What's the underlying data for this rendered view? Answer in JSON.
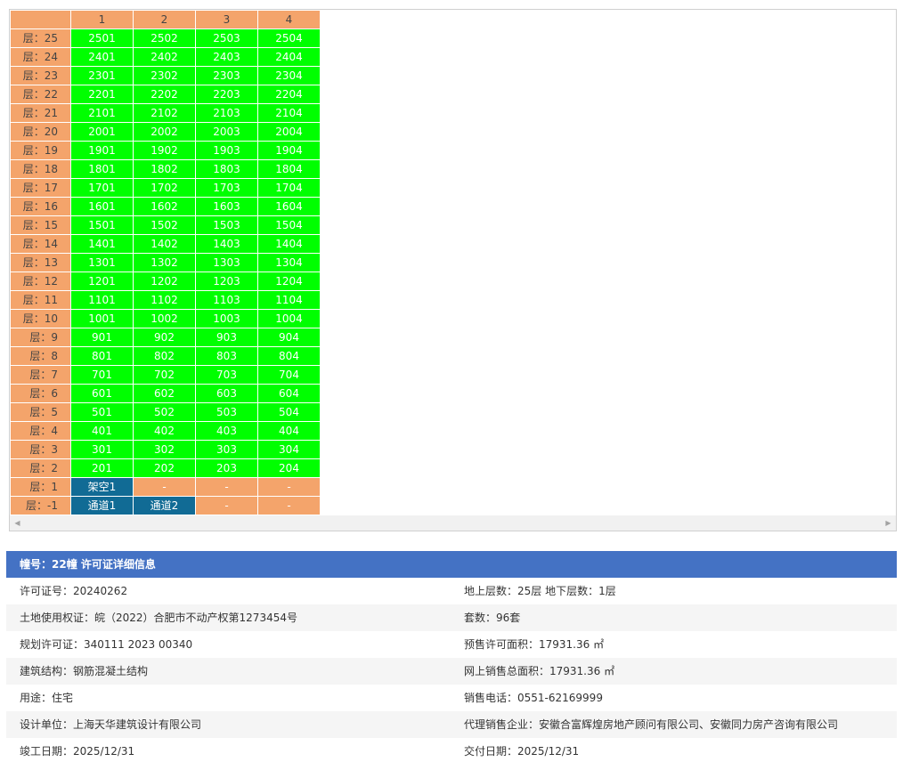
{
  "grid": {
    "columns": [
      "1",
      "2",
      "3",
      "4"
    ],
    "rows": [
      {
        "floor": "层：25",
        "units": [
          "2501",
          "2502",
          "2503",
          "2504"
        ],
        "types": [
          "unit",
          "unit",
          "unit",
          "unit"
        ]
      },
      {
        "floor": "层：24",
        "units": [
          "2401",
          "2402",
          "2403",
          "2404"
        ],
        "types": [
          "unit",
          "unit",
          "unit",
          "unit"
        ]
      },
      {
        "floor": "层：23",
        "units": [
          "2301",
          "2302",
          "2303",
          "2304"
        ],
        "types": [
          "unit",
          "unit",
          "unit",
          "unit"
        ]
      },
      {
        "floor": "层：22",
        "units": [
          "2201",
          "2202",
          "2203",
          "2204"
        ],
        "types": [
          "unit",
          "unit",
          "unit",
          "unit"
        ]
      },
      {
        "floor": "层：21",
        "units": [
          "2101",
          "2102",
          "2103",
          "2104"
        ],
        "types": [
          "unit",
          "unit",
          "unit",
          "unit"
        ]
      },
      {
        "floor": "层：20",
        "units": [
          "2001",
          "2002",
          "2003",
          "2004"
        ],
        "types": [
          "unit",
          "unit",
          "unit",
          "unit"
        ]
      },
      {
        "floor": "层：19",
        "units": [
          "1901",
          "1902",
          "1903",
          "1904"
        ],
        "types": [
          "unit",
          "unit",
          "unit",
          "unit"
        ]
      },
      {
        "floor": "层：18",
        "units": [
          "1801",
          "1802",
          "1803",
          "1804"
        ],
        "types": [
          "unit",
          "unit",
          "unit",
          "unit"
        ]
      },
      {
        "floor": "层：17",
        "units": [
          "1701",
          "1702",
          "1703",
          "1704"
        ],
        "types": [
          "unit",
          "unit",
          "unit",
          "unit"
        ]
      },
      {
        "floor": "层：16",
        "units": [
          "1601",
          "1602",
          "1603",
          "1604"
        ],
        "types": [
          "unit",
          "unit",
          "unit",
          "unit"
        ]
      },
      {
        "floor": "层：15",
        "units": [
          "1501",
          "1502",
          "1503",
          "1504"
        ],
        "types": [
          "unit",
          "unit",
          "unit",
          "unit"
        ]
      },
      {
        "floor": "层：14",
        "units": [
          "1401",
          "1402",
          "1403",
          "1404"
        ],
        "types": [
          "unit",
          "unit",
          "unit",
          "unit"
        ]
      },
      {
        "floor": "层：13",
        "units": [
          "1301",
          "1302",
          "1303",
          "1304"
        ],
        "types": [
          "unit",
          "unit",
          "unit",
          "unit"
        ]
      },
      {
        "floor": "层：12",
        "units": [
          "1201",
          "1202",
          "1203",
          "1204"
        ],
        "types": [
          "unit",
          "unit",
          "unit",
          "unit"
        ]
      },
      {
        "floor": "层：11",
        "units": [
          "1101",
          "1102",
          "1103",
          "1104"
        ],
        "types": [
          "unit",
          "unit",
          "unit",
          "unit"
        ]
      },
      {
        "floor": "层：10",
        "units": [
          "1001",
          "1002",
          "1003",
          "1004"
        ],
        "types": [
          "unit",
          "unit",
          "unit",
          "unit"
        ]
      },
      {
        "floor": "层：9",
        "units": [
          "901",
          "902",
          "903",
          "904"
        ],
        "types": [
          "unit",
          "unit",
          "unit",
          "unit"
        ]
      },
      {
        "floor": "层：8",
        "units": [
          "801",
          "802",
          "803",
          "804"
        ],
        "types": [
          "unit",
          "unit",
          "unit",
          "unit"
        ]
      },
      {
        "floor": "层：7",
        "units": [
          "701",
          "702",
          "703",
          "704"
        ],
        "types": [
          "unit",
          "unit",
          "unit",
          "unit"
        ]
      },
      {
        "floor": "层：6",
        "units": [
          "601",
          "602",
          "603",
          "604"
        ],
        "types": [
          "unit",
          "unit",
          "unit",
          "unit"
        ]
      },
      {
        "floor": "层：5",
        "units": [
          "501",
          "502",
          "503",
          "504"
        ],
        "types": [
          "unit",
          "unit",
          "unit",
          "unit"
        ]
      },
      {
        "floor": "层：4",
        "units": [
          "401",
          "402",
          "403",
          "404"
        ],
        "types": [
          "unit",
          "unit",
          "unit",
          "unit"
        ]
      },
      {
        "floor": "层：3",
        "units": [
          "301",
          "302",
          "303",
          "304"
        ],
        "types": [
          "unit",
          "unit",
          "unit",
          "unit"
        ]
      },
      {
        "floor": "层：2",
        "units": [
          "201",
          "202",
          "203",
          "204"
        ],
        "types": [
          "unit",
          "unit",
          "unit",
          "unit"
        ]
      },
      {
        "floor": "层：1",
        "units": [
          "架空1",
          "-",
          "-",
          "-"
        ],
        "types": [
          "special",
          "empty",
          "empty",
          "empty"
        ]
      },
      {
        "floor": "层：-1",
        "units": [
          "通道1",
          "通道2",
          "-",
          "-"
        ],
        "types": [
          "special",
          "special",
          "empty",
          "empty"
        ]
      }
    ],
    "colors": {
      "header": "#f4a46b",
      "available": "#00ff00",
      "special": "#116b95"
    }
  },
  "scrollbar": {
    "left_icon": "arrow-left-icon",
    "right_icon": "arrow-right-icon"
  },
  "info": {
    "title": "幢号：22幢 许可证详细信息",
    "rows": [
      {
        "left": "许可证号：20240262",
        "right": "地上层数：25层  地下层数：1层"
      },
      {
        "left": "土地使用权证：皖（2022）合肥市不动产权第1273454号",
        "right": "套数：96套"
      },
      {
        "left": "规划许可证：340111 2023 00340",
        "right": "预售许可面积：17931.36 ㎡"
      },
      {
        "left": "建筑结构：钢筋混凝土结构",
        "right": "网上销售总面积：17931.36 ㎡"
      },
      {
        "left": "用途：住宅",
        "right": "销售电话：0551-62169999"
      },
      {
        "left": "设计单位：上海天华建筑设计有限公司",
        "right": "代理销售企业：安徽合富辉煌房地产顾问有限公司、安徽同力房产咨询有限公司"
      },
      {
        "left": "竣工日期：2025/12/31",
        "right": "交付日期：2025/12/31"
      }
    ]
  }
}
